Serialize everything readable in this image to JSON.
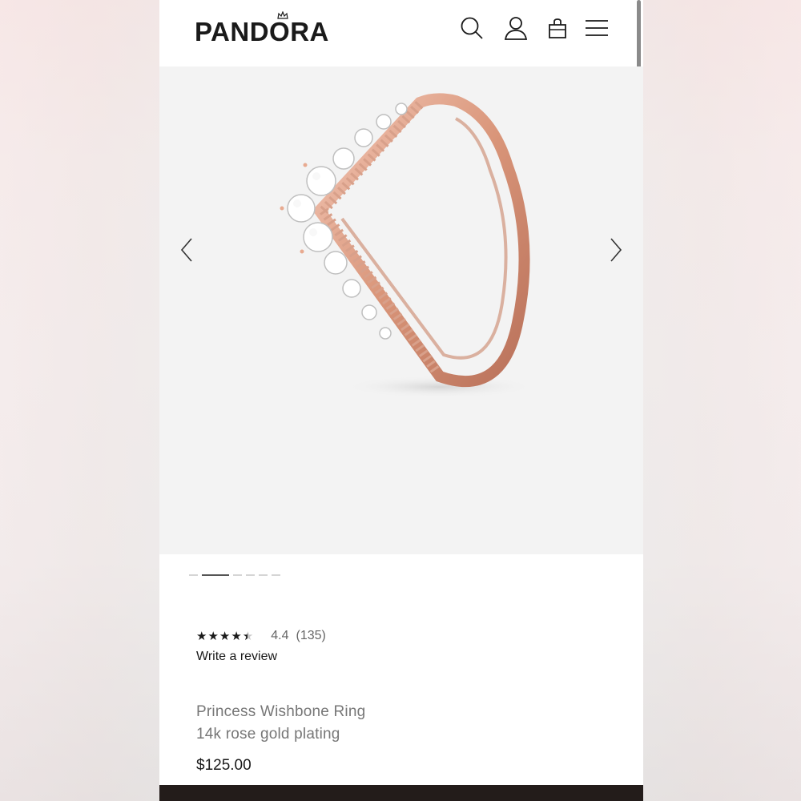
{
  "header": {
    "logo_text": "PANDORA",
    "icons": [
      "search-icon",
      "account-icon",
      "bag-icon",
      "menu-icon"
    ]
  },
  "gallery": {
    "image": "rose-gold-wishbone-ring",
    "slide_count": 6,
    "active_slide": 2
  },
  "product": {
    "rating_value": "4.4",
    "rating_stars": 4.4,
    "review_count": "(135)",
    "write_review_label": "Write a review",
    "name": "Princess Wishbone Ring",
    "material": "14k rose gold plating",
    "price": "$125.00"
  },
  "colors": {
    "text_primary": "#1a1a1a",
    "text_secondary": "#777777",
    "gallery_bg": "#f3f3f3",
    "rose_gold": "#e0a48c",
    "bottom_bar": "#231c1a"
  }
}
